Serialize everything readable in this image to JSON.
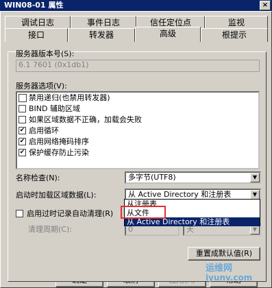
{
  "window": {
    "title": "WIN08-01 属性",
    "close": "×"
  },
  "tabs_row1": [
    "调试日志",
    "事件日志",
    "信任定位点",
    "监视"
  ],
  "tabs_row2": [
    "接口",
    "转发器",
    "高级",
    "根提示"
  ],
  "server_version": {
    "label": "服务器版本号(S):",
    "value": "6.1 7601 (0x1db1)"
  },
  "server_options": {
    "label": "服务器选项(V):",
    "items": [
      {
        "label": "禁用递归(也禁用转发器)",
        "checked": false
      },
      {
        "label": "BIND 辅助区域",
        "checked": false
      },
      {
        "label": "如果区域数据不正确，加载会失败",
        "checked": false
      },
      {
        "label": "启用循环",
        "checked": true
      },
      {
        "label": "启用网络掩码排序",
        "checked": true
      },
      {
        "label": "保护缓存防止污染",
        "checked": true
      }
    ]
  },
  "name_check": {
    "label": "名称检查(N):",
    "value": "多字节(UTF8)"
  },
  "load_zone": {
    "label": "启动时加载区域数据(L):",
    "value": "从 Active Directory 和注册表"
  },
  "dropdown": [
    "从注册表",
    "从文件",
    "从 Active Directory 和注册表"
  ],
  "scavenging": {
    "label": "启用过时记录自动清理(R)",
    "period_label": "清理周期(C):",
    "period_value": "0",
    "unit": "天"
  },
  "reset_button": "重置成默认值(R)",
  "footer": {
    "ok": "确定",
    "cancel": "取消",
    "apply": "应用(A)",
    "help": "帮助"
  },
  "watermark": {
    "line1": "运维网",
    "line2": "iyunv.com"
  },
  "colors": {
    "titlebar": "#0a246a",
    "face": "#d4d0c8",
    "highlight_box": "#e03030"
  }
}
